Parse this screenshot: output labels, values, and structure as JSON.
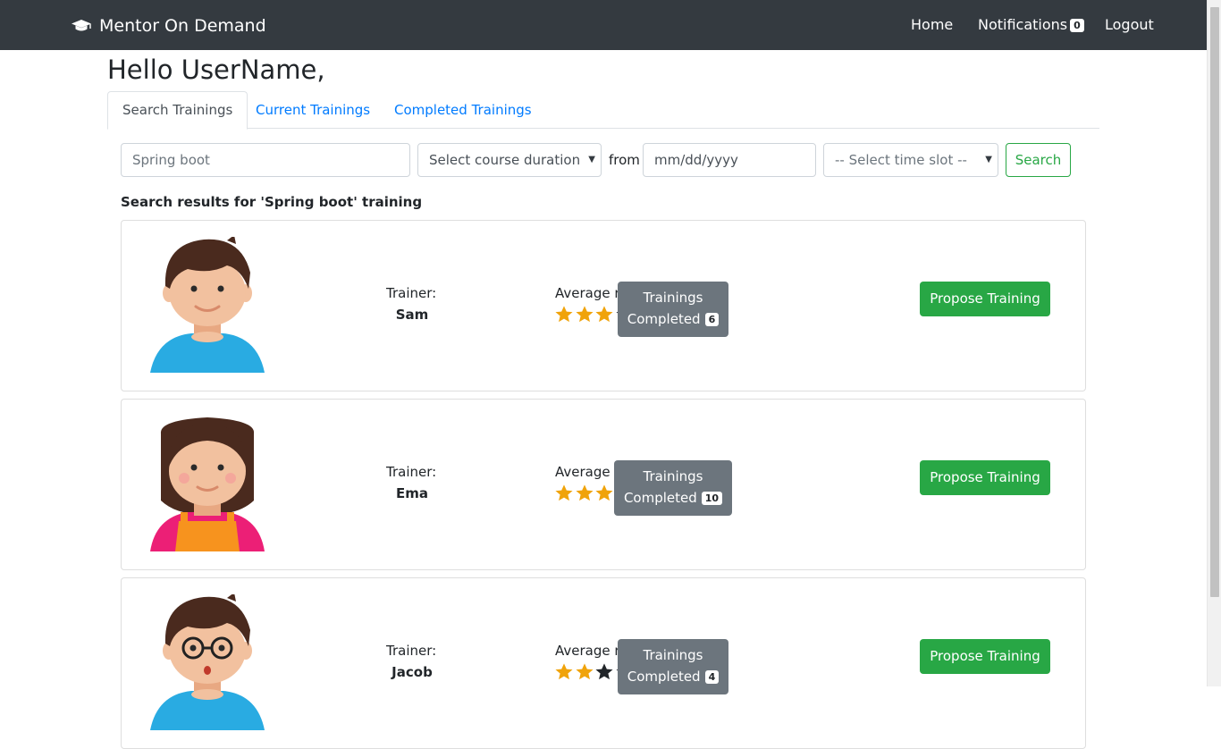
{
  "navbar": {
    "brand": "Mentor On Demand",
    "home": "Home",
    "notifications": "Notifications",
    "notifications_count": "0",
    "logout": "Logout"
  },
  "greeting": "Hello UserName,",
  "tabs": [
    {
      "label": "Search Trainings",
      "active": true
    },
    {
      "label": "Current Trainings",
      "active": false
    },
    {
      "label": "Completed Trainings",
      "active": false
    }
  ],
  "search": {
    "keyword_value": "Spring boot",
    "duration_select": "Select course duration",
    "from_label": "from",
    "date_placeholder": "mm/dd/yyyy",
    "time_slot_select": "-- Select time slot --",
    "button": "Search"
  },
  "results_title": "Search results for 'Spring boot' training",
  "trainer_label": "Trainer:",
  "rating_label": "Average rating:",
  "trainings_line1": "Trainings",
  "trainings_line2": "Completed",
  "propose_label": "Propose Training",
  "colors": {
    "star_filled": "#f0a30a",
    "star_empty": "#212529",
    "primary_green": "#28a745",
    "link_blue": "#007bff"
  },
  "trainers": [
    {
      "name": "Sam",
      "rating": 3,
      "trainings_completed": "6",
      "avatar": "boy-avatar"
    },
    {
      "name": "Ema",
      "rating": 4,
      "trainings_completed": "10",
      "avatar": "girl-avatar"
    },
    {
      "name": "Jacob",
      "rating": 2,
      "trainings_completed": "4",
      "avatar": "boy-glasses-avatar"
    }
  ]
}
